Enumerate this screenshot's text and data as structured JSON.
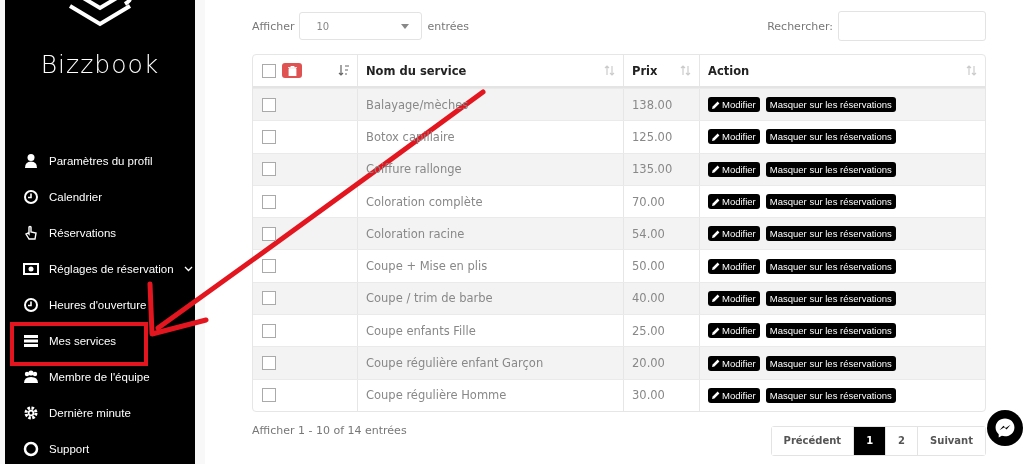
{
  "sidebar": {
    "brand": "Bizzbook",
    "items": [
      {
        "label": "Paramètres du profil",
        "has_submenu": false
      },
      {
        "label": "Calendrier",
        "has_submenu": false
      },
      {
        "label": "Réservations",
        "has_submenu": false
      },
      {
        "label": "Réglages de réservation",
        "has_submenu": true
      },
      {
        "label": "Heures d'ouverture",
        "has_submenu": false
      },
      {
        "label": "Mes services",
        "has_submenu": false
      },
      {
        "label": "Membre de l'équipe",
        "has_submenu": false
      },
      {
        "label": "Dernière minute",
        "has_submenu": false
      },
      {
        "label": "Support",
        "has_submenu": false
      }
    ]
  },
  "length_control": {
    "label_before": "Afficher",
    "value": "10",
    "label_after": "entrées"
  },
  "search": {
    "label": "Rechercher:"
  },
  "table": {
    "select_all_checked": false,
    "columns": [
      "Nom du service",
      "Prix",
      "Action"
    ],
    "rows": [
      {
        "checked": false,
        "name": "Balayage/mèches",
        "price": "138.00",
        "edit": "Modifier",
        "hide": "Masquer sur les réservations"
      },
      {
        "checked": false,
        "name": "Botox capillaire",
        "price": "125.00",
        "edit": "Modifier",
        "hide": "Masquer sur les réservations"
      },
      {
        "checked": false,
        "name": "Coiffure rallonge",
        "price": "135.00",
        "edit": "Modifier",
        "hide": "Masquer sur les réservations"
      },
      {
        "checked": false,
        "name": "Coloration complète",
        "price": "70.00",
        "edit": "Modifier",
        "hide": "Masquer sur les réservations"
      },
      {
        "checked": false,
        "name": "Coloration racine",
        "price": "54.00",
        "edit": "Modifier",
        "hide": "Masquer sur les réservations"
      },
      {
        "checked": false,
        "name": "Coupe + Mise en plis",
        "price": "50.00",
        "edit": "Modifier",
        "hide": "Masquer sur les réservations"
      },
      {
        "checked": false,
        "name": "Coupe / trim de barbe",
        "price": "40.00",
        "edit": "Modifier",
        "hide": "Masquer sur les réservations"
      },
      {
        "checked": false,
        "name": "Coupe enfants Fille",
        "price": "25.00",
        "edit": "Modifier",
        "hide": "Masquer sur les réservations"
      },
      {
        "checked": false,
        "name": "Coupe régulière enfant Garçon",
        "price": "20.00",
        "edit": "Modifier",
        "hide": "Masquer sur les réservations"
      },
      {
        "checked": false,
        "name": "Coupe régulière Homme",
        "price": "30.00",
        "edit": "Modifier",
        "hide": "Masquer sur les réservations"
      }
    ]
  },
  "info": "Afficher 1 - 10 of 14 entrées",
  "pagination": [
    {
      "label": "Précédent",
      "selected": false
    },
    {
      "label": "1",
      "selected": true
    },
    {
      "label": "2",
      "selected": false
    },
    {
      "label": "Suivant",
      "selected": false
    }
  ]
}
